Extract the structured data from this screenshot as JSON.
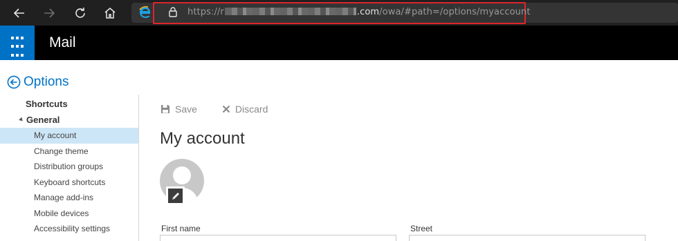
{
  "browser": {
    "url": {
      "scheme": "https://",
      "host_prefix": "r",
      "host_suffix": ".com",
      "path": "/owa/#path=/options/myaccount"
    },
    "icons": [
      "back-arrow-icon",
      "forward-arrow-icon",
      "refresh-icon",
      "home-icon",
      "edge-logo-icon",
      "lock-icon"
    ]
  },
  "app": {
    "title": "Mail",
    "accent": "#0072c6"
  },
  "sidebar": {
    "title": "Options",
    "shortcuts_label": "Shortcuts",
    "general_label": "General",
    "items": [
      {
        "label": "My account",
        "selected": true
      },
      {
        "label": "Change theme",
        "selected": false
      },
      {
        "label": "Distribution groups",
        "selected": false
      },
      {
        "label": "Keyboard shortcuts",
        "selected": false
      },
      {
        "label": "Manage add-ins",
        "selected": false
      },
      {
        "label": "Mobile devices",
        "selected": false
      },
      {
        "label": "Accessibility settings",
        "selected": false
      }
    ]
  },
  "toolbar": {
    "save_label": "Save",
    "discard_label": "Discard"
  },
  "main": {
    "title": "My account",
    "fields": {
      "first_name_label": "First name",
      "first_name_value": "",
      "street_label": "Street",
      "street_value": ""
    }
  }
}
